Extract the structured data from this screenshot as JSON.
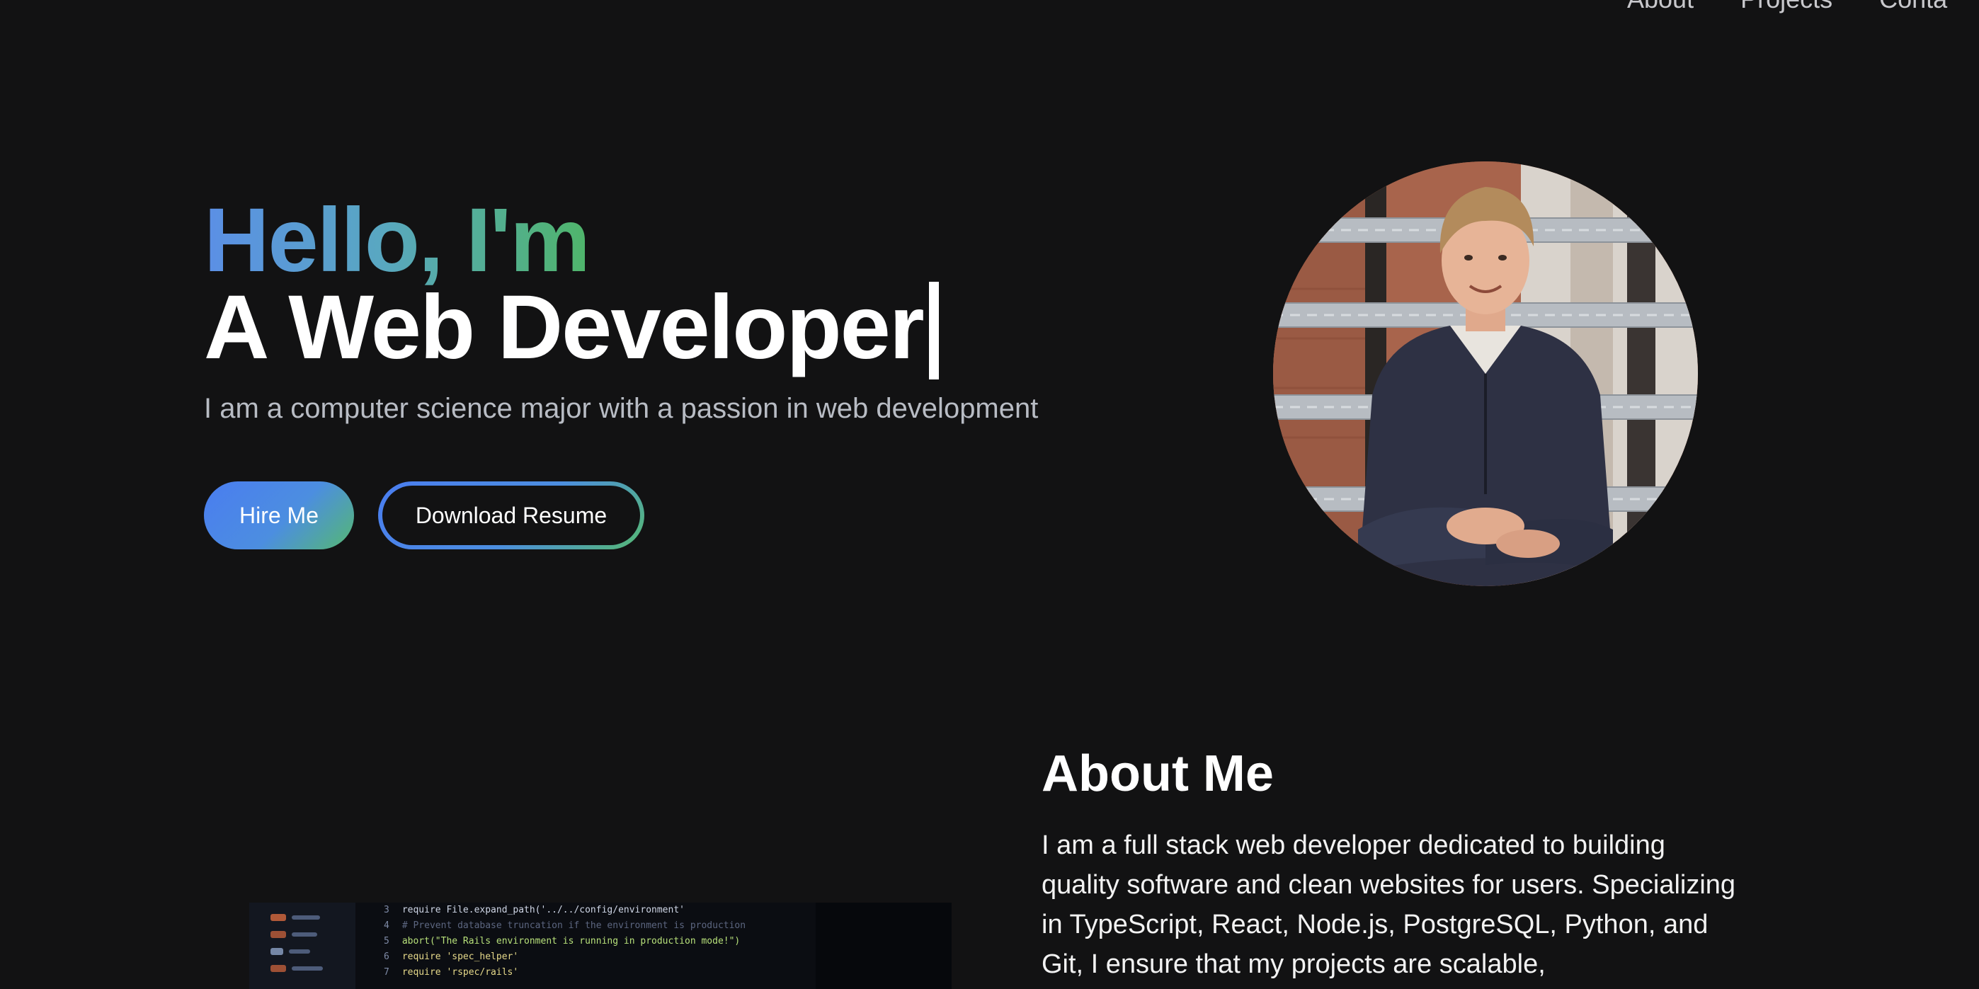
{
  "nav": {
    "items": [
      {
        "label": "About"
      },
      {
        "label": "Projects"
      },
      {
        "label": "Conta"
      }
    ]
  },
  "hero": {
    "greeting": "Hello, I'm",
    "title": "A Web Developer",
    "subtitle": "I am a computer science major with a passion in web development",
    "primary_button": "Hire Me",
    "secondary_button": "Download Resume"
  },
  "about": {
    "title": "About Me",
    "paragraph": "I am a full stack web developer dedicated to building quality software and clean websites for users. Specializing in TypeScript, React, Node.js, PostgreSQL, Python, and Git, I ensure that my projects are scalable,"
  },
  "code_image": {
    "lines": [
      {
        "number": "3",
        "text": "require File.expand_path('../../config/environment'"
      },
      {
        "number": "4",
        "text": "# Prevent database truncation if the environment is production"
      },
      {
        "number": "5",
        "text": "abort(\"The Rails environment is running in production mode!\")"
      },
      {
        "number": "6",
        "text": "require 'spec_helper'"
      },
      {
        "number": "7",
        "text": "require 'rspec/rails'"
      }
    ]
  },
  "colors": {
    "background": "#121213",
    "gradient_blue": "#4a7df0",
    "gradient_green": "#55b872",
    "text_muted": "#b8bcc4"
  }
}
